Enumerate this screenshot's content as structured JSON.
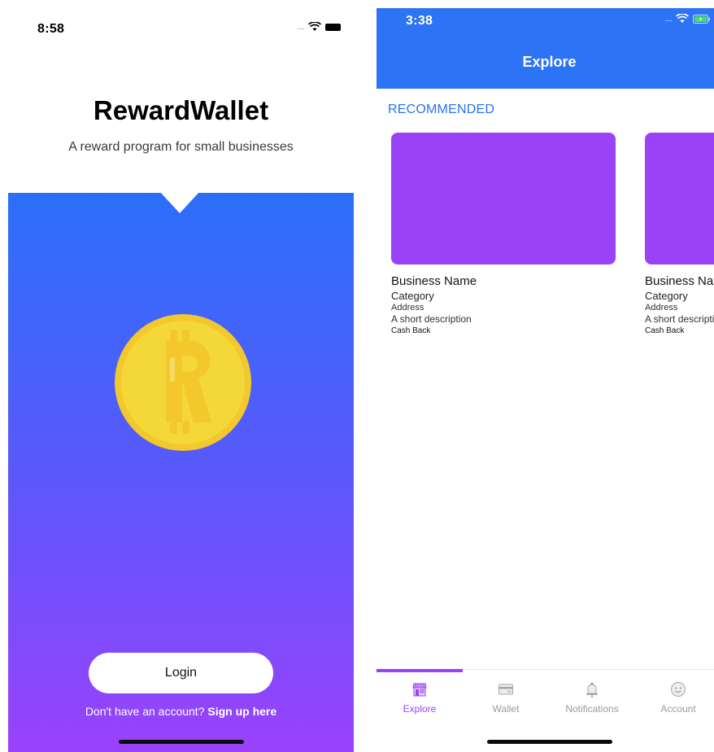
{
  "login_screen": {
    "status_time": "8:58",
    "app_title": "RewardWallet",
    "subtitle": "A reward program for small businesses",
    "login_label": "Login",
    "signup_prompt": "Don't have an account? ",
    "signup_link": "Sign up here",
    "icons": [
      "signal-dots-icon",
      "wifi-icon",
      "battery-icon",
      "reward-coin-icon"
    ],
    "colors": {
      "gradient_top": "#2b6ff9",
      "gradient_bottom": "#9a42fb",
      "coin": "#f2c82c"
    }
  },
  "explore_screen": {
    "status_time": "3:38",
    "title": "Explore",
    "section_label": "RECOMMENDED",
    "cards": [
      {
        "name": "Business Name",
        "category": "Category",
        "address": "Address",
        "description": "A short description",
        "cashback": "Cash Back"
      },
      {
        "name": "Business Name",
        "category": "Category",
        "address": "Address",
        "description": "A short description",
        "cashback": "Cash Back"
      }
    ],
    "tabs": [
      {
        "label": "Explore",
        "icon": "storefront-icon",
        "active": true
      },
      {
        "label": "Wallet",
        "icon": "wallet-card-icon",
        "active": false
      },
      {
        "label": "Notifications",
        "icon": "bell-icon",
        "active": false
      },
      {
        "label": "Account",
        "icon": "account-face-icon",
        "active": false
      }
    ],
    "colors": {
      "header": "#2c73f5",
      "accent": "#9a42f7",
      "section_label": "#2a72ee"
    }
  }
}
